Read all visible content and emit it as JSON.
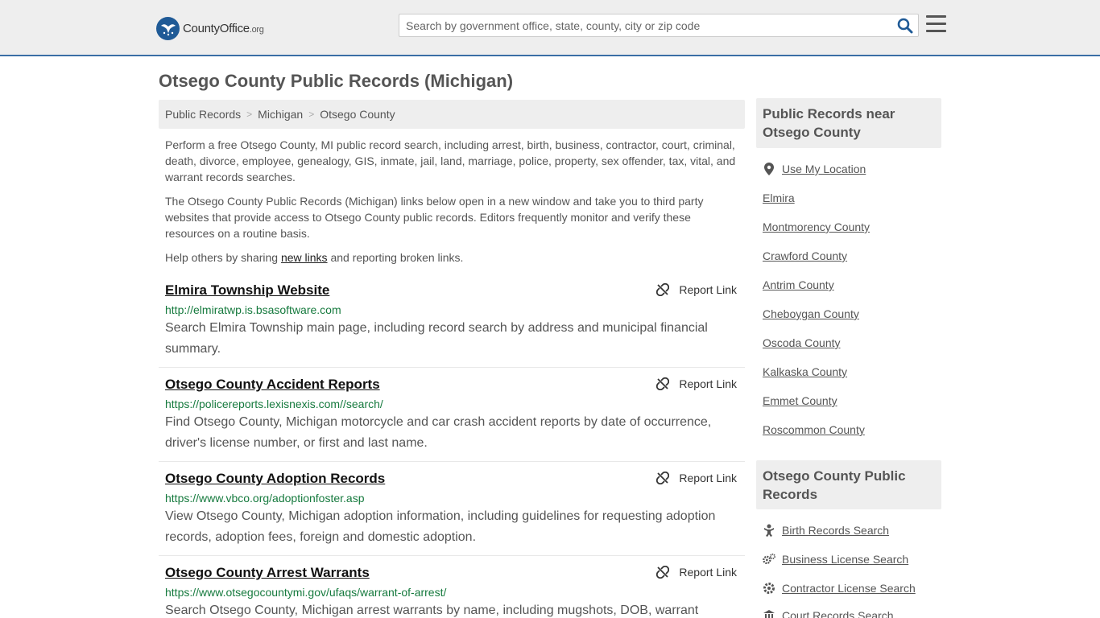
{
  "header": {
    "logo_main": "CountyOffice",
    "logo_suffix": ".org",
    "search_placeholder": "Search by government office, state, county, city or zip code"
  },
  "page": {
    "title": "Otsego County Public Records (Michigan)"
  },
  "breadcrumb": [
    "Public Records",
    "Michigan",
    "Otsego County"
  ],
  "intro": {
    "p1": "Perform a free Otsego County, MI public record search, including arrest, birth, business, contractor, court, criminal, death, divorce, employee, genealogy, GIS, inmate, jail, land, marriage, police, property, sex offender, tax, vital, and warrant records searches.",
    "p2": "The Otsego County Public Records (Michigan) links below open in a new window and take you to third party websites that provide access to Otsego County public records. Editors frequently monitor and verify these resources on a routine basis.",
    "p3_before": "Help others by sharing ",
    "p3_link": "new links",
    "p3_after": " and reporting broken links."
  },
  "report_label": "Report Link",
  "records": [
    {
      "title": "Elmira Township Website",
      "url": "http://elmiratwp.is.bsasoftware.com",
      "desc": "Search Elmira Township main page, including record search by address and municipal financial summary."
    },
    {
      "title": "Otsego County Accident Reports",
      "url": "https://policereports.lexisnexis.com//search/",
      "desc": "Find Otsego County, Michigan motorcycle and car crash accident reports by date of occurrence, driver's license number, or first and last name."
    },
    {
      "title": "Otsego County Adoption Records",
      "url": "https://www.vbco.org/adoptionfoster.asp",
      "desc": "View Otsego County, Michigan adoption information, including guidelines for requesting adoption records, adoption fees, foreign and domestic adoption."
    },
    {
      "title": "Otsego County Arrest Warrants",
      "url": "https://www.otsegocountymi.gov/ufaqs/warrant-of-arrest/",
      "desc": "Search Otsego County, Michigan arrest warrants by name, including mugshots, DOB, warrant"
    }
  ],
  "sidebar": {
    "nearby_heading": "Public Records near Otsego County",
    "use_location": "Use My Location",
    "nearby": [
      "Elmira",
      "Montmorency County",
      "Crawford County",
      "Antrim County",
      "Cheboygan County",
      "Oscoda County",
      "Kalkaska County",
      "Emmet County",
      "Roscommon County"
    ],
    "records_heading": "Otsego County Public Records",
    "record_links": [
      {
        "label": "Birth Records Search",
        "icon": "baby-icon"
      },
      {
        "label": "Business License Search",
        "icon": "gears-icon"
      },
      {
        "label": "Contractor License Search",
        "icon": "gear-icon"
      },
      {
        "label": "Court Records Search",
        "icon": "courthouse-icon"
      }
    ]
  },
  "colors": {
    "header_bg": "#eeeeee",
    "accent": "#3a6ea5",
    "url_green": "#167a3e",
    "search_icon": "#1f5a96"
  }
}
